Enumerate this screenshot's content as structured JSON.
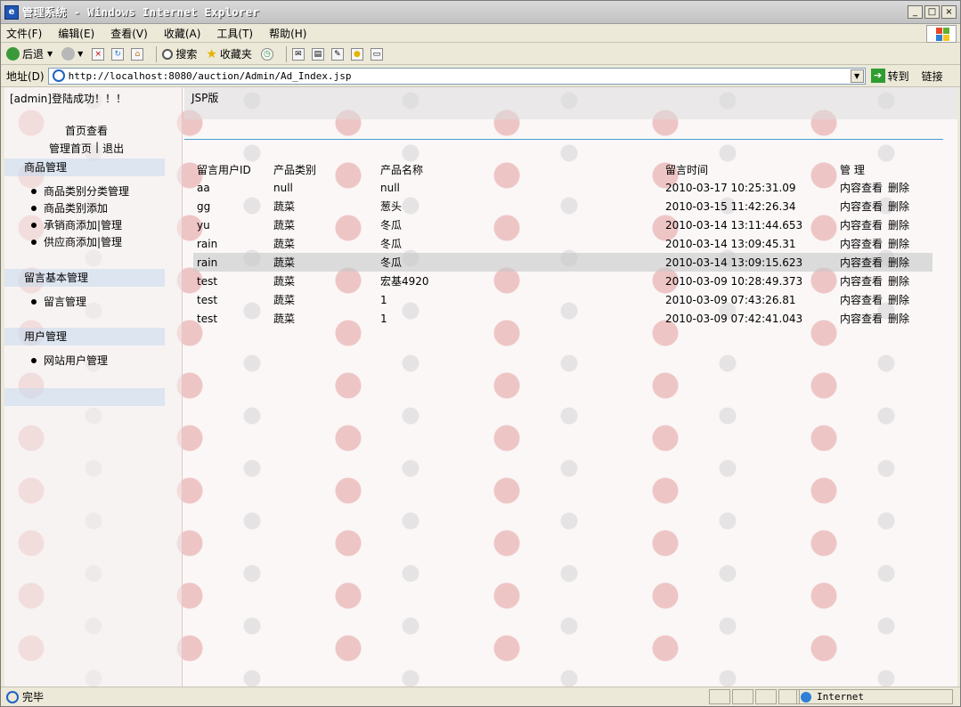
{
  "window": {
    "title": "管理系统 - Windows Internet Explorer",
    "buttons": {
      "minimize": "_",
      "maximize": "□",
      "close": "×"
    }
  },
  "menubar": [
    "文件(F)",
    "编辑(E)",
    "查看(V)",
    "收藏(A)",
    "工具(T)",
    "帮助(H)"
  ],
  "toolbar": {
    "back": "后退",
    "search": "搜索",
    "favorites": "收藏夹"
  },
  "addressbar": {
    "label": "地址(D)",
    "url": "http://localhost:8080/auction/Admin/Ad_Index.jsp",
    "go": "转到",
    "links": "链接"
  },
  "sidebar": {
    "login_status": "[admin]登陆成功！！！",
    "home": "首页查看",
    "admin_home": "管理首页",
    "separator": "|",
    "logout": "退出",
    "sections": [
      {
        "title": "商品管理",
        "items": [
          "商品类别分类管理",
          "商品类别添加",
          "承销商添加|管理",
          "供应商添加|管理"
        ]
      },
      {
        "title": "留言基本管理",
        "items": [
          "留言管理"
        ]
      },
      {
        "title": "用户管理",
        "items": [
          "网站用户管理"
        ]
      }
    ]
  },
  "main": {
    "header": "JSP版",
    "table": {
      "columns": [
        "留言用户ID",
        "产品类别",
        "产品名称",
        "留言时间",
        "管 理"
      ],
      "rows": [
        {
          "user": "aa",
          "category": "null",
          "product": "null",
          "time": "2010-03-17 10:25:31.09"
        },
        {
          "user": "gg",
          "category": "蔬菜",
          "product": "葱头",
          "time": "2010-03-15 11:42:26.34"
        },
        {
          "user": "yu",
          "category": "蔬菜",
          "product": "冬瓜",
          "time": "2010-03-14 13:11:44.653"
        },
        {
          "user": "rain",
          "category": "蔬菜",
          "product": "冬瓜",
          "time": "2010-03-14 13:09:45.31"
        },
        {
          "user": "rain",
          "category": "蔬菜",
          "product": "冬瓜",
          "time": "2010-03-14 13:09:15.623"
        },
        {
          "user": "test",
          "category": "蔬菜",
          "product": "宏基4920",
          "time": "2010-03-09 10:28:49.373"
        },
        {
          "user": "test",
          "category": "蔬菜",
          "product": "1",
          "time": "2010-03-09 07:43:26.81"
        },
        {
          "user": "test",
          "category": "蔬菜",
          "product": "1",
          "time": "2010-03-09 07:42:41.043"
        }
      ],
      "action_view": "内容查看",
      "action_delete": "删除",
      "highlighted_row": 4
    }
  },
  "statusbar": {
    "status": "完毕",
    "zone": "Internet"
  },
  "colors": {
    "accent_line": "#4a9bd0",
    "section_bg": "#c4d8ec"
  }
}
